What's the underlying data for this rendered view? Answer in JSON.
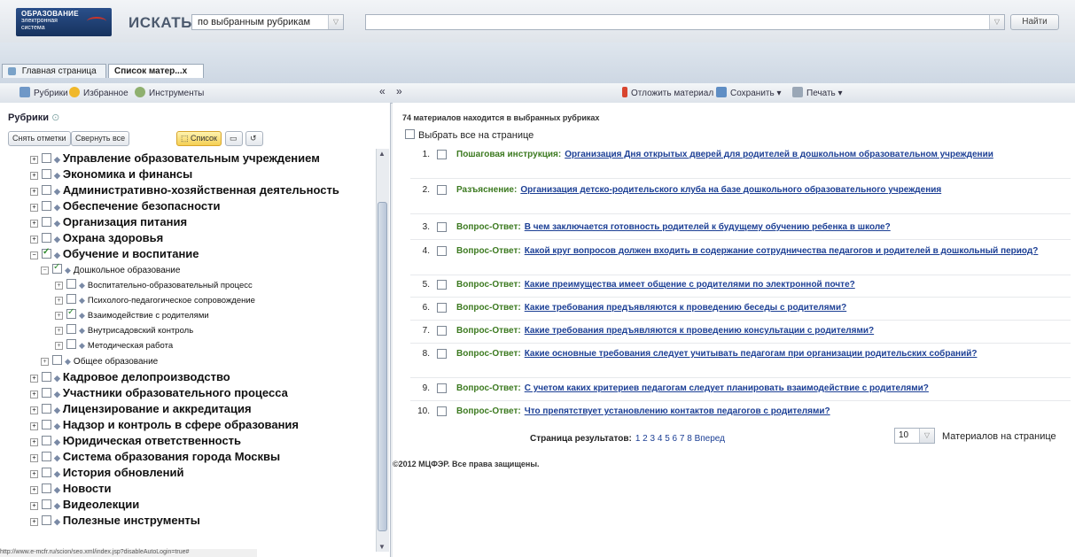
{
  "header": {
    "logo_line1": "ОБРАЗОВАНИЕ",
    "logo_line2": "электронная",
    "logo_line3": "система",
    "search_title": "ИСКАТЬ",
    "scope_value": "по выбранным рубрикам",
    "search_value": "",
    "search_button": "Найти"
  },
  "tabs": [
    {
      "label": "Главная страница"
    },
    {
      "label": "Список матер...х"
    }
  ],
  "toolbar": {
    "rubrics": "Рубрики",
    "favorites": "Избранное",
    "tools": "Инструменты",
    "collapse_left": "«",
    "expand_right": "»",
    "postpone": "Отложить материал",
    "save": "Сохранить ▾",
    "print": "Печать ▾"
  },
  "left": {
    "title": "Рубрики",
    "buttons": {
      "uncheck": "Снять отметки",
      "collapse": "Свернуть все",
      "list": "Список"
    },
    "tree": [
      {
        "label": "Управление образовательным учреждением",
        "checked": false
      },
      {
        "label": "Экономика и финансы",
        "checked": false
      },
      {
        "label": "Административно-хозяйственная деятельность",
        "checked": false
      },
      {
        "label": "Обеспечение безопасности",
        "checked": false
      },
      {
        "label": "Организация питания",
        "checked": false
      },
      {
        "label": "Охрана здоровья",
        "checked": false
      },
      {
        "label": "Обучение и воспитание",
        "checked": true
      },
      {
        "label": "Дошкольное образование",
        "checked": true
      },
      {
        "label": "Воспитательно-образовательный процесс",
        "checked": false
      },
      {
        "label": "Психолого-педагогическое сопровождение",
        "checked": false
      },
      {
        "label": "Взаимодействие с родителями",
        "checked": true
      },
      {
        "label": "Внутрисадовский контроль",
        "checked": false
      },
      {
        "label": "Методическая работа",
        "checked": false
      },
      {
        "label": "Общее образование",
        "checked": false
      },
      {
        "label": "Кадровое делопроизводство",
        "checked": false
      },
      {
        "label": "Участники образовательного процесса",
        "checked": false
      },
      {
        "label": "Лицензирование и аккредитация",
        "checked": false
      },
      {
        "label": "Надзор и контроль в сфере образования",
        "checked": false
      },
      {
        "label": "Юридическая ответственность",
        "checked": false
      },
      {
        "label": "Система образования города Москвы",
        "checked": false
      },
      {
        "label": "История обновлений",
        "checked": false
      },
      {
        "label": "Новости",
        "checked": false
      },
      {
        "label": "Видеолекции",
        "checked": false
      },
      {
        "label": "Полезные инструменты",
        "checked": false
      }
    ],
    "status_url": "http://www.e-mcfr.ru/scion/seo.xml/index.jsp?disableAutoLogin=true#"
  },
  "results": {
    "count_line": "74 материалов находится в выбранных рубриках",
    "select_all": "Выбрать все на странице",
    "items": [
      {
        "num": "1.",
        "type": "Пошаговая инструкция:",
        "title": "Организация Дня открытых дверей для родителей в дошкольном образовательном учреждении"
      },
      {
        "num": "2.",
        "type": "Разъяснение:",
        "title": "Организация детско-родительского клуба на базе дошкольного образовательного учреждения"
      },
      {
        "num": "3.",
        "type": "Вопрос-Ответ:",
        "title": "В чем заключается готовность родителей к будущему обучению ребенка в школе?"
      },
      {
        "num": "4.",
        "type": "Вопрос-Ответ:",
        "title": "Какой круг вопросов должен входить в содержание сотрудничества педагогов и родителей в дошкольный период?"
      },
      {
        "num": "5.",
        "type": "Вопрос-Ответ:",
        "title": "Какие преимущества имеет общение с родителями по электронной почте?"
      },
      {
        "num": "6.",
        "type": "Вопрос-Ответ:",
        "title": "Какие требования предъявляются к проведению беседы с родителями?"
      },
      {
        "num": "7.",
        "type": "Вопрос-Ответ:",
        "title": "Какие требования предъявляются к проведению консультации с родителями?"
      },
      {
        "num": "8.",
        "type": "Вопрос-Ответ:",
        "title": "Какие основные требования следует учитывать педагогам при организации родительских собраний?"
      },
      {
        "num": "9.",
        "type": "Вопрос-Ответ:",
        "title": "С учетом каких критериев педагогам следует планировать взаимодействие с родителями?"
      },
      {
        "num": "10.",
        "type": "Вопрос-Ответ:",
        "title": "Что препятствует установлению контактов педагогов с родителями?"
      }
    ],
    "pager_label": "Страница результатов:",
    "pages": "1 2 3 4 5 6 7 8 Вперед",
    "per_page_value": "10",
    "per_page_label": "Материалов на странице",
    "copyright": "©2012 МЦФЭР. Все права защищены."
  }
}
